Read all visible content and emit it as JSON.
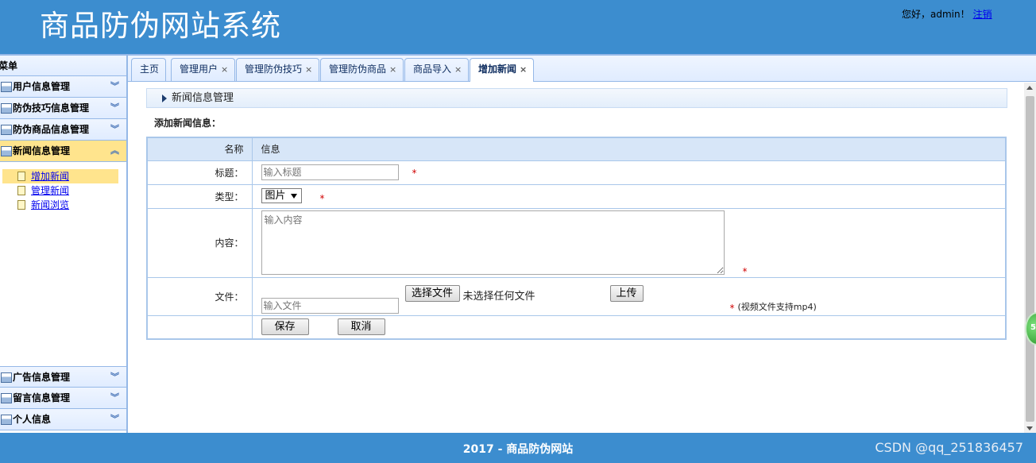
{
  "header": {
    "title": "商品防伪网站系统",
    "greeting": "您好，admin！",
    "logout_label": "注销"
  },
  "sidebar": {
    "title": "菜单",
    "sections": [
      {
        "label": "用户信息管理",
        "icon": "user-panel-icon"
      },
      {
        "label": "防伪技巧信息管理",
        "icon": "panel-icon"
      },
      {
        "label": "防伪商品信息管理",
        "icon": "panel-icon"
      },
      {
        "label": "新闻信息管理",
        "icon": "panel-icon"
      },
      {
        "label": "广告信息管理",
        "icon": "panel-icon"
      },
      {
        "label": "留言信息管理",
        "icon": "panel-icon"
      },
      {
        "label": "个人信息",
        "icon": "panel-icon"
      }
    ],
    "expanded_section": "新闻信息管理",
    "sub_items": [
      {
        "label": "增加新闻"
      },
      {
        "label": "管理新闻"
      },
      {
        "label": "新闻浏览"
      }
    ],
    "selected_sub_item": "增加新闻"
  },
  "tabs": [
    {
      "label": "主页",
      "closable": false
    },
    {
      "label": "管理用户",
      "closable": true
    },
    {
      "label": "管理防伪技巧",
      "closable": true
    },
    {
      "label": "管理防伪商品",
      "closable": true
    },
    {
      "label": "商品导入",
      "closable": true
    },
    {
      "label": "增加新闻",
      "closable": true,
      "active": true
    }
  ],
  "close_glyph": "×",
  "panel": {
    "breadcrumb": "新闻信息管理",
    "form_title": "添加新闻信息："
  },
  "form": {
    "header": {
      "col1": "名称",
      "col2": "信息"
    },
    "title_label": "标题：",
    "title_placeholder": "输入标题",
    "type_label": "类型：",
    "type_value": "图片",
    "content_label": "内容：",
    "content_placeholder": "输入内容",
    "file_label": "文件：",
    "file_placeholder": "输入文件",
    "choose_file_label": "选择文件",
    "no_file_text": "未选择任何文件",
    "upload_label": "上传",
    "required_mark": "*",
    "file_hint": "(视频文件支持mp4)",
    "save_label": "保存",
    "cancel_label": "取消"
  },
  "footer": {
    "text": "2017 - 商品防伪网站",
    "watermark": "CSDN @qq_251836457"
  },
  "floating_badge": {
    "text": "5"
  },
  "colors": {
    "header_bg": "#3c8dcf",
    "border": "#95b8e7",
    "selected": "#ffe48d",
    "required": "#d00000"
  }
}
